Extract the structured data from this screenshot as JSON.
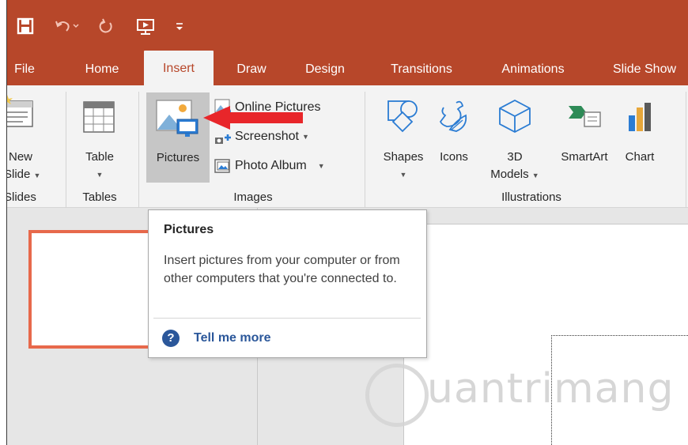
{
  "quick_access": {
    "icons": [
      "save-icon",
      "undo-icon",
      "redo-icon",
      "start-from-beginning-icon",
      "customize-qat-icon"
    ]
  },
  "tabs": [
    {
      "label": "File",
      "active": false
    },
    {
      "label": "Home",
      "active": false
    },
    {
      "label": "Insert",
      "active": true
    },
    {
      "label": "Draw",
      "active": false
    },
    {
      "label": "Design",
      "active": false
    },
    {
      "label": "Transitions",
      "active": false
    },
    {
      "label": "Animations",
      "active": false
    },
    {
      "label": "Slide Show",
      "active": false
    }
  ],
  "ribbon": {
    "new_slide": {
      "line1": "New",
      "line2": "Slide",
      "group": "Slides"
    },
    "table": {
      "label": "Table",
      "group": "Tables"
    },
    "pictures": {
      "label": "Pictures"
    },
    "online_pictures": {
      "label": "Online Pictures"
    },
    "screenshot": {
      "label": "Screenshot"
    },
    "photo_album": {
      "label": "Photo Album"
    },
    "images_group": "Images",
    "shapes": {
      "label": "Shapes"
    },
    "icons": {
      "label": "Icons"
    },
    "models_3d": {
      "line1": "3D",
      "line2": "Models"
    },
    "smartart": {
      "label": "SmartArt"
    },
    "chart": {
      "label": "Chart"
    },
    "illustrations_group": "Illustrations"
  },
  "tooltip": {
    "title": "Pictures",
    "description": "Insert pictures from your computer or from other computers that you're connected to.",
    "help_label": "Tell me more"
  },
  "watermark": "uantrimang",
  "colors": {
    "accent": "#b7472a",
    "thumbnail_border": "#e7694b",
    "arrow": "#e8262a",
    "help_blue": "#2b579a"
  }
}
